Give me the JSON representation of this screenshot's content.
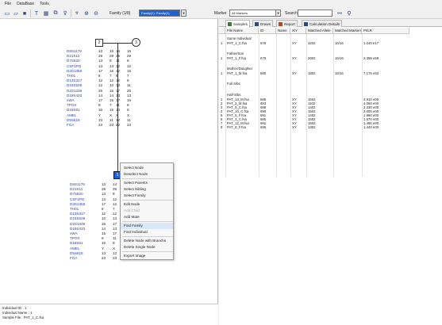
{
  "menu": [
    "File",
    "DataBase",
    "Tools"
  ],
  "toolbar": {
    "family_label": "Family (1/8)",
    "family_value": "Family(1): Family(1)",
    "marker_label": "Marker",
    "marker_value": "All Markers",
    "search_label": "Search"
  },
  "pedigree": {
    "parent_left_id": "2",
    "parent_right_id": "3",
    "child_id": "1",
    "left_genotypes": [
      {
        "marker": "D8S1179",
        "a1": "13",
        "a2": "15"
      },
      {
        "marker": "D21S11",
        "a1": "28",
        "a2": "29"
      },
      {
        "marker": "D7S820",
        "a1": "13",
        "a2": "8"
      },
      {
        "marker": "CSF1PO",
        "a1": "13",
        "a2": "13"
      },
      {
        "marker": "D3S1358",
        "a1": "17",
        "a2": "15"
      },
      {
        "marker": "TH01",
        "a1": "8",
        "a2": "7"
      },
      {
        "marker": "D13S317",
        "a1": "12",
        "a2": "12"
      },
      {
        "marker": "D16S539",
        "a1": "12",
        "a2": "10"
      },
      {
        "marker": "D2S1338",
        "a1": "25",
        "a2": "15"
      },
      {
        "marker": "D19S433",
        "a1": "14",
        "a2": "14"
      },
      {
        "marker": "vWA",
        "a1": "17",
        "a2": "15"
      },
      {
        "marker": "TPOX",
        "a1": "8",
        "a2": "7"
      },
      {
        "marker": "D18S51",
        "a1": "16",
        "a2": "15"
      },
      {
        "marker": "AMEL",
        "a1": "Y",
        "a2": "X"
      },
      {
        "marker": "D5S818",
        "a1": "13",
        "a2": "11"
      },
      {
        "marker": "FGA",
        "a1": "23",
        "a2": "23"
      }
    ],
    "right_genotypes": [
      {
        "a1": "14",
        "a2": "15"
      },
      {
        "a1": "29",
        "a2": "29"
      },
      {
        "a1": "11",
        "a2": "8"
      },
      {
        "a1": "12",
        "a2": "12"
      },
      {
        "a1": "12",
        "a2": "15"
      },
      {
        "a1": "9",
        "a2": "7"
      },
      {
        "a1": "12",
        "a2": "8"
      },
      {
        "a1": "13",
        "a2": "11"
      },
      {
        "a1": "17",
        "a2": "25"
      },
      {
        "a1": "13",
        "a2": "13"
      },
      {
        "a1": "17",
        "a2": "16"
      },
      {
        "a1": "11",
        "a2": "8"
      },
      {
        "a1": "14",
        "a2": "9"
      },
      {
        "a1": "X",
        "a2": "X"
      },
      {
        "a1": "12",
        "a2": "11"
      },
      {
        "a1": "22",
        "a2": "23"
      }
    ],
    "child_genotypes": [
      {
        "marker": "D8S1179",
        "a1": "13",
        "a2": "14"
      },
      {
        "marker": "D21S11",
        "a1": "28",
        "a2": "29"
      },
      {
        "marker": "D7S820",
        "a1": "13",
        "a2": "8"
      },
      {
        "marker": "CSF1PO",
        "a1": "13",
        "a2": "12"
      },
      {
        "marker": "D3S1358",
        "a1": "17",
        "a2": "12"
      },
      {
        "marker": "TH01",
        "a1": "8",
        "a2": "7"
      },
      {
        "marker": "D13S317",
        "a1": "12",
        "a2": "12"
      },
      {
        "marker": "D16S539",
        "a1": "10",
        "a2": "13"
      },
      {
        "marker": "D2S1338",
        "a1": "25",
        "a2": "17"
      },
      {
        "marker": "D19S433",
        "a1": "14",
        "a2": "13"
      },
      {
        "marker": "vWA",
        "a1": "15",
        "a2": "17"
      },
      {
        "marker": "TPOX",
        "a1": "8",
        "a2": "11"
      },
      {
        "marker": "D18S51",
        "a1": "15",
        "a2": "9"
      },
      {
        "marker": "AMEL",
        "a1": "Y",
        "a2": "X"
      },
      {
        "marker": "D5S818",
        "a1": "13",
        "a2": "12"
      },
      {
        "marker": "FGA",
        "a1": "23",
        "a2": "23"
      }
    ]
  },
  "context_menu": {
    "items": [
      {
        "label": "Select Node",
        "disabled": false,
        "hover": false
      },
      {
        "label": "Deselect Node",
        "disabled": false,
        "hover": false
      },
      {
        "label": "Select Parents",
        "disabled": false,
        "hover": false
      },
      {
        "label": "Select Sibling",
        "disabled": false,
        "hover": false
      },
      {
        "label": "Select Family",
        "disabled": false,
        "hover": false
      },
      {
        "label": "Edit Node",
        "disabled": false,
        "hover": false
      },
      {
        "label": "Add Child",
        "disabled": true,
        "hover": false
      },
      {
        "label": "Add Mate",
        "disabled": false,
        "hover": false
      },
      {
        "label": "Find Family",
        "disabled": false,
        "hover": true
      },
      {
        "label": "Find Individual",
        "disabled": false,
        "hover": false
      },
      {
        "label": "Delete Node with Branchs",
        "disabled": false,
        "hover": false
      },
      {
        "label": "Delete Single Node",
        "disabled": false,
        "hover": false
      },
      {
        "label": "Export Image",
        "disabled": false,
        "hover": false
      }
    ]
  },
  "status": {
    "line1": "Individual ID : 1",
    "line2": "Individual Name : 1",
    "line3": "Sample File : PAT_1_C.fsa"
  },
  "tabs": [
    {
      "label": "Samples",
      "active": true
    },
    {
      "label": "Drawn",
      "active": false
    },
    {
      "label": "Report",
      "active": false
    },
    {
      "label": "Calculation Details",
      "active": false
    }
  ],
  "grid": {
    "headers": [
      "File Name",
      "ID",
      "Name",
      "X/Y",
      "Matched Allele",
      "Matched Markers",
      "PI/LR"
    ],
    "groups": [
      {
        "label": "Same Individual",
        "rows": [
          {
            "n": "1",
            "file": "PAT_1_C.fsa",
            "id": "678",
            "name": "",
            "xy": "XY",
            "allele": "3202",
            "markers": "16/16",
            "pi": "1.240 e17"
          }
        ]
      },
      {
        "label": "Father/Son",
        "rows": [
          {
            "n": "1",
            "file": "PAT_1_F.fsa",
            "id": "679",
            "name": "",
            "xy": "XY",
            "allele": "2002",
            "markers": "16/16",
            "pi": "2.398 e59"
          }
        ]
      },
      {
        "label": "Mother/Daughter",
        "rows": [
          {
            "n": "1",
            "file": "PAT_1_M.fsa",
            "id": "680",
            "name": "",
            "xy": "XY",
            "allele": "1802",
            "markers": "16/16",
            "pi": "7.175 e53"
          }
        ]
      },
      {
        "label": "Full Sibs",
        "rows": []
      },
      {
        "label": "Half-Sibs",
        "rows": [
          {
            "n": "1",
            "file": "PAT_13_M.fsa",
            "id": "685",
            "name": "",
            "xy": "XY",
            "allele": "1502",
            "markers": "",
            "pi": "4.910 e00"
          },
          {
            "n": "2",
            "file": "PAT_2_M.fsa",
            "id": "683",
            "name": "",
            "xy": "XY",
            "allele": "1102",
            "markers": "",
            "pi": "4.060 e00"
          },
          {
            "n": "3",
            "file": "PAT_5_C.fsa",
            "id": "688",
            "name": "",
            "xy": "XY",
            "allele": "1402",
            "markers": "",
            "pi": "2.330 e00"
          },
          {
            "n": "4",
            "file": "PAT_10_C.fsa",
            "id": "690",
            "name": "",
            "xy": "XY",
            "allele": "1502",
            "markers": "",
            "pi": "2.000 e00"
          },
          {
            "n": "5",
            "file": "PAT_5_F.fsa",
            "id": "691",
            "name": "",
            "xy": "XY",
            "allele": "1402",
            "markers": "",
            "pi": "1.960 e00"
          },
          {
            "n": "6",
            "file": "PAT_3_C.fsa",
            "id": "686",
            "name": "",
            "xy": "XY",
            "allele": "1502",
            "markers": "",
            "pi": "1.670 e00"
          },
          {
            "n": "7",
            "file": "PAT_12_M.fsa",
            "id": "692",
            "name": "",
            "xy": "XY",
            "allele": "1502",
            "markers": "",
            "pi": "1.490 e00"
          },
          {
            "n": "8",
            "file": "PAT_8_F.fsa",
            "id": "695",
            "name": "",
            "xy": "XY",
            "allele": "1302",
            "markers": "",
            "pi": "1.440 e00"
          }
        ]
      }
    ]
  },
  "colors": {
    "marker_text": "#2b3fa8",
    "selection": "#1e63d6",
    "menu_hover": "#d9e8fb"
  }
}
